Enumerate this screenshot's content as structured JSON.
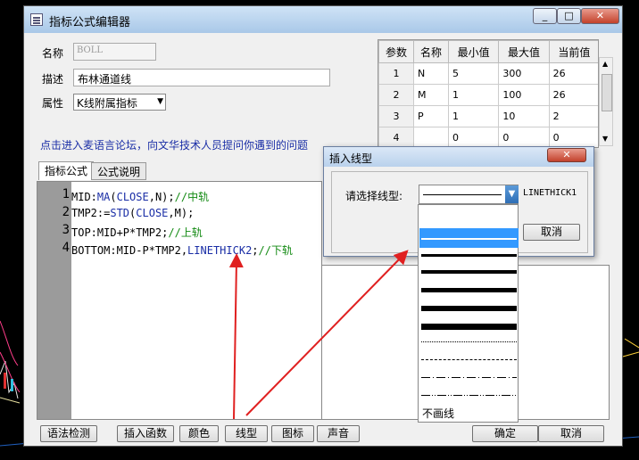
{
  "window": {
    "title": "指标公式编辑器",
    "min_label": "_",
    "max_label": "□",
    "close_label": "✕"
  },
  "form": {
    "name_label": "名称",
    "name_value": "BOLL",
    "desc_label": "描述",
    "desc_value": "布林通道线",
    "attr_label": "属性",
    "attr_value": "K线附属指标"
  },
  "params": {
    "headers": [
      "参数",
      "名称",
      "最小值",
      "最大值",
      "当前值"
    ],
    "rows": [
      [
        "1",
        "N",
        "5",
        "300",
        "26"
      ],
      [
        "2",
        "M",
        "1",
        "100",
        "26"
      ],
      [
        "3",
        "P",
        "1",
        "10",
        "2"
      ],
      [
        "4",
        "",
        "0",
        "0",
        "0"
      ]
    ]
  },
  "forum_link": "点击进入麦语言论坛，向文华技术人员提问你遇到的问题",
  "tabs": {
    "formula": "指标公式",
    "explain": "公式说明"
  },
  "code": {
    "line_numbers": [
      "1",
      "2",
      "3",
      "4"
    ],
    "l1": {
      "a": "MID:",
      "b": "MA",
      "c": "(",
      "d": "CLOSE",
      "e": ",N);",
      "f": "//中轨"
    },
    "l2": {
      "a": "TMP2:=",
      "b": "STD",
      "c": "(",
      "d": "CLOSE",
      "e": ",M);"
    },
    "l3": {
      "a": "TOP:MID+P*TMP2;",
      "f": "//上轨"
    },
    "l4": {
      "a": "BOTTOM:MID-P*TMP2,",
      "b": "LINETHICK2",
      "c": ";",
      "f": "//下轨"
    }
  },
  "buttons": {
    "syntax_check": "语法检测",
    "insert_func": "插入函数",
    "color": "颜色",
    "line_style": "线型",
    "icon": "图标",
    "sound": "声音",
    "ok": "确定",
    "cancel": "取消"
  },
  "dialog": {
    "title": "插入线型",
    "close_label": "✕",
    "prompt": "请选择线型:",
    "current_style": "LINETHICK1",
    "cancel": "取消",
    "no_draw": "不画线",
    "highlight_color": "#3399ff"
  }
}
